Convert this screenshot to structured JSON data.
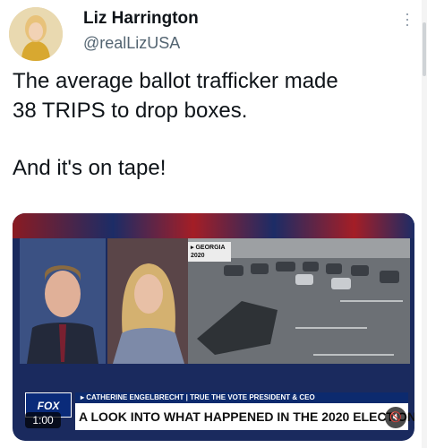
{
  "author": {
    "display_name": "Liz Harrington",
    "handle": "@realLizUSA"
  },
  "tweet": {
    "line1": "The average ballot trafficker made",
    "line2": "38 TRIPS to drop boxes.",
    "line3": "And it's on tape!"
  },
  "video": {
    "overlay_tag_line1": "▸ GEORGIA",
    "overlay_tag_line2": "2020",
    "chyron_top": "▸ CATHERINE ENGELBRECHT | TRUE THE VOTE PRESIDENT & CEO",
    "chyron_main": "A LOOK INTO WHAT HAPPENED IN THE 2020 ELECTION",
    "logo_text": "FOX",
    "timestamp": "1:00",
    "mute_icon": "speaker-muted-icon"
  },
  "colors": {
    "handle": "#536471",
    "chyron_bar": "#0c2a6e"
  }
}
